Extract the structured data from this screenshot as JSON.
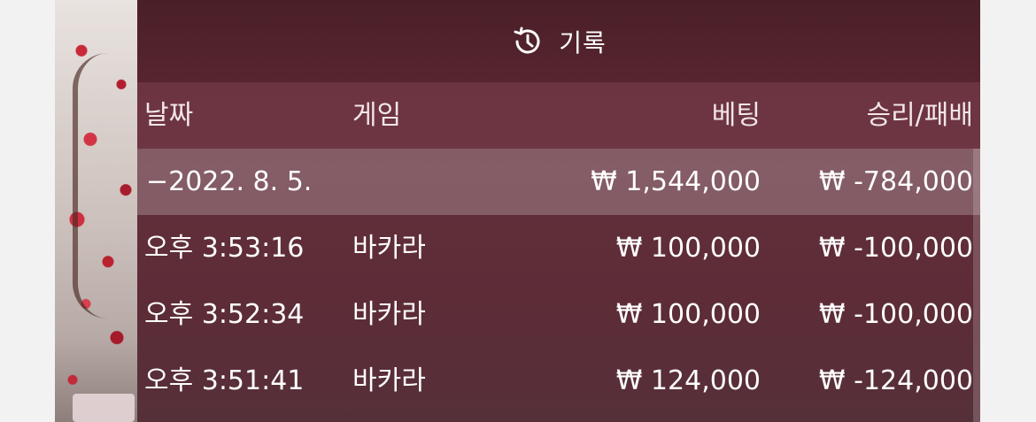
{
  "panel": {
    "title": "기록",
    "icon": "history-icon"
  },
  "table": {
    "columns": [
      "날짜",
      "게임",
      "베팅",
      "승리/패배"
    ],
    "summary": {
      "date": "−2022. 8. 5.",
      "game": "",
      "bet": "₩ 1,544,000",
      "result": "₩ -784,000"
    },
    "rows": [
      {
        "time": "오후 3:53:16",
        "game": "바카라",
        "bet": "₩ 100,000",
        "result": "₩ -100,000"
      },
      {
        "time": "오후 3:52:34",
        "game": "바카라",
        "bet": "₩ 100,000",
        "result": "₩ -100,000"
      },
      {
        "time": "오후 3:51:41",
        "game": "바카라",
        "bet": "₩ 124,000",
        "result": "₩ -124,000"
      }
    ]
  },
  "colors": {
    "panel_bg": "#5a2530",
    "page_bg": "#f3f2f3",
    "text": "#ffffff"
  }
}
